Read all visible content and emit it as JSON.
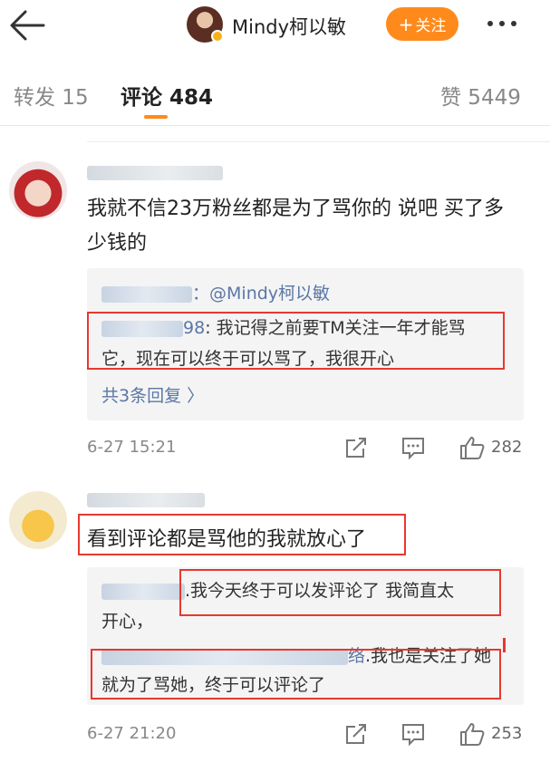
{
  "header": {
    "user_name": "Mindy柯以敏",
    "follow_label": "关注",
    "follow_plus": "+"
  },
  "tabs": [
    {
      "label": "转发 15"
    },
    {
      "label": "评论 484"
    },
    {
      "label": "赞 5449"
    }
  ],
  "comments": [
    {
      "text": "我就不信23万粉丝都是为了骂你的 说吧 买了多少钱的",
      "reply_line1_at": "@Mindy柯以敏",
      "reply_line1_sep": "：",
      "reply_line2_name_tail": "98",
      "reply_line2_text": ": 我记得之前要TM关注一年才能骂",
      "reply_line3_text": "它，现在可以终于可以骂了，我很开心",
      "more_replies": "共3条回复 〉",
      "time": "6-27 15:21",
      "likes": "282"
    },
    {
      "text": "看到评论都是骂他的我就放心了",
      "reply1_text": ".我今天终于可以发评论了  我简直太",
      "reply1_cont": "开心，",
      "reply2_name_tail": "络",
      "reply2_text": ".我也是关注了她",
      "reply2_cont": "就为了骂她，终于可以评论了",
      "time": "6-27 21:20",
      "likes": "253"
    }
  ],
  "colors": {
    "accent": "#ff8a1c",
    "link": "#5a77a6",
    "highlight_box": "#e8382f"
  },
  "icons": [
    "back-arrow-icon",
    "more-dots-icon",
    "repost-icon",
    "comment-icon",
    "like-icon"
  ]
}
